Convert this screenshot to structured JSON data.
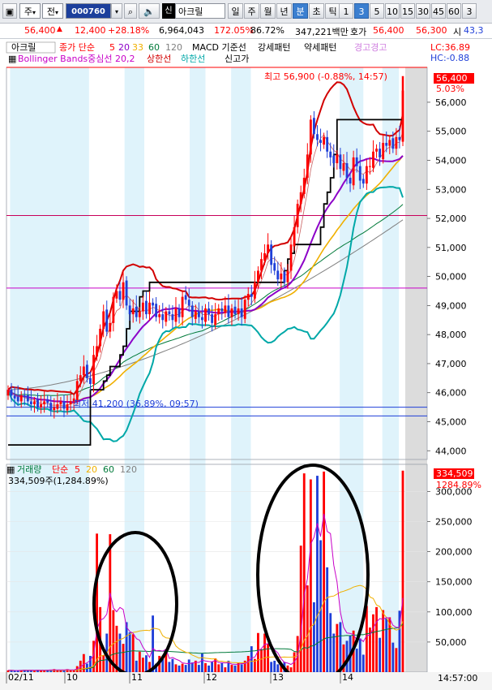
{
  "toolbar": {
    "period_label": "주",
    "prev_label": "전",
    "code_value": "000760",
    "stock_name": "아크릴",
    "credit_badge": "신",
    "period_tabs": [
      "일",
      "주",
      "월",
      "년",
      "분",
      "초",
      "틱"
    ],
    "active_period": "분",
    "interval_tabs": [
      "1",
      "3",
      "5",
      "10",
      "15",
      "30",
      "45",
      "60",
      "3"
    ],
    "active_interval": "3"
  },
  "infobar": {
    "price": "56,400",
    "change": "12,400",
    "change_pct": "+28.18%",
    "volume": "6,964,043",
    "vol_ratio": "172.05%",
    "turnover": "86.72%",
    "amount": "347,221백만",
    "quote_label": "호가",
    "ask": "56,400",
    "bid": "56,300",
    "open_label": "시",
    "open": "43,3"
  },
  "colors": {
    "up": "#ff0000",
    "down": "#1f3fd8",
    "ma5": "#ff0000",
    "ma20": "#8c00c8",
    "ma60": "#f0b000",
    "ma120": "#007a3a",
    "bb_upper": "#d20000",
    "bb_lower": "#00a8a8",
    "new_high": "#000000",
    "session_band": "#dff3fb"
  },
  "legend": {
    "stock_label": "아크릴",
    "ma_label": "종가 단순",
    "ma_periods": [
      "5",
      "20",
      "33",
      "60",
      "120"
    ],
    "indicators": [
      "MACD 기준선",
      "강세패턴",
      "약세패턴"
    ],
    "bearish_note": "경고경고",
    "bb_label": "Bollinger Bands중심선 20,2",
    "bb_upper_label": "상한선",
    "bb_lower_label": "하한선",
    "new_high_label": "신고가",
    "lc_label": "LC:36.89",
    "hc_label": "HC:-0.88"
  },
  "annotations": {
    "high_text": "최고 56,900 (-0.88%, 14:57)",
    "low_text": "최저 41,200 (36.89%, 09:57)",
    "price_tag": "56,400",
    "pct_tag": "5.03%"
  },
  "volume_legend": {
    "label": "거래량",
    "ma_label": "단순",
    "ma_periods": [
      "5",
      "20",
      "60",
      "120"
    ],
    "summary": "334,509주(1,284.89%)",
    "value_tag": "334,509",
    "pct_tag": "1284.89%"
  },
  "chart_data": [
    {
      "type": "candlestick",
      "title": "아크릴 3분봉",
      "x": [
        "02/11",
        "10",
        "11",
        "12",
        "13",
        "14"
      ],
      "y_ticks": [
        44000,
        45000,
        46000,
        47000,
        48000,
        49000,
        50000,
        51000,
        52000,
        53000,
        54000,
        55000,
        56000
      ],
      "ylim": [
        43700,
        57200
      ],
      "last_price": 56400,
      "high": 56900,
      "low": 45200,
      "ma20_start": 46100,
      "ma20_end": 54100,
      "ma60_end": 53950,
      "ma120_end": 51950,
      "horizontal_lines": [
        52100,
        49600,
        45500,
        45200
      ],
      "closes": [
        46100,
        45900,
        45800,
        45700,
        45900,
        45850,
        45700,
        45600,
        45700,
        45500,
        45600,
        45700,
        45650,
        45400,
        45500,
        45600,
        45700,
        45450,
        45600,
        45700,
        45800,
        46400,
        46600,
        46900,
        46500,
        46300,
        47300,
        47600,
        48200,
        48800,
        48100,
        48400,
        49300,
        49500,
        49200,
        49800,
        49000,
        48700,
        48900,
        48600,
        48800,
        49100,
        48700,
        49100,
        49000,
        48600,
        48700,
        48500,
        48800,
        48700,
        48500,
        48900,
        48600,
        49300,
        49200,
        49000,
        48600,
        48800,
        48600,
        48500,
        48900,
        48700,
        48400,
        48700,
        48900,
        48800,
        49000,
        48600,
        48900,
        48700,
        48900,
        48600,
        49200,
        49400,
        49300,
        49800,
        50200,
        50600,
        50800,
        51100,
        50400,
        50200,
        49900,
        50100,
        49800,
        50200,
        51100,
        51700,
        52500,
        52900,
        53400,
        54200,
        55400,
        54900,
        54700,
        54600,
        54800,
        54300,
        54100,
        53900,
        54200,
        53700,
        53900,
        53400,
        53200,
        54100,
        53800,
        53300,
        53200,
        53800,
        53800,
        54300,
        54400,
        54100,
        54600,
        54500,
        54700,
        54400,
        54800,
        54700,
        56400
      ]
    },
    {
      "type": "bar",
      "title": "거래량",
      "ylim": [
        0,
        345000
      ],
      "y_ticks": [
        50000,
        100000,
        150000,
        200000,
        250000,
        300000
      ],
      "last_value": 334509,
      "values": [
        3000,
        3000,
        2000,
        3000,
        3000,
        4000,
        3000,
        3000,
        2000,
        4000,
        3000,
        3000,
        4000,
        4000,
        5000,
        3000,
        3000,
        4000,
        5000,
        3000,
        4000,
        10000,
        19000,
        30000,
        14000,
        27000,
        52000,
        230000,
        108000,
        28000,
        64000,
        229000,
        103000,
        77000,
        64000,
        47000,
        83000,
        66000,
        63000,
        19000,
        34000,
        24000,
        28000,
        17000,
        94000,
        14000,
        27000,
        22000,
        34000,
        17000,
        22000,
        13000,
        11000,
        14000,
        12000,
        21000,
        16000,
        19000,
        12000,
        31000,
        15000,
        11000,
        17000,
        23000,
        13000,
        15000,
        8000,
        19000,
        12000,
        11000,
        16000,
        13000,
        19000,
        27000,
        43000,
        22000,
        65000,
        38000,
        64000,
        47000,
        17000,
        19000,
        13000,
        15000,
        17000,
        11000,
        8000,
        33000,
        60000,
        210000,
        330000,
        144000,
        320000,
        116000,
        326000,
        219000,
        333000,
        174000,
        98000,
        64000,
        80000,
        83000,
        46000,
        52000,
        61000,
        69000,
        39000,
        56000,
        29000,
        110000,
        74000,
        96000,
        108000,
        57000,
        103000,
        89000,
        91000,
        49000,
        40000,
        102000,
        334509
      ]
    }
  ]
}
